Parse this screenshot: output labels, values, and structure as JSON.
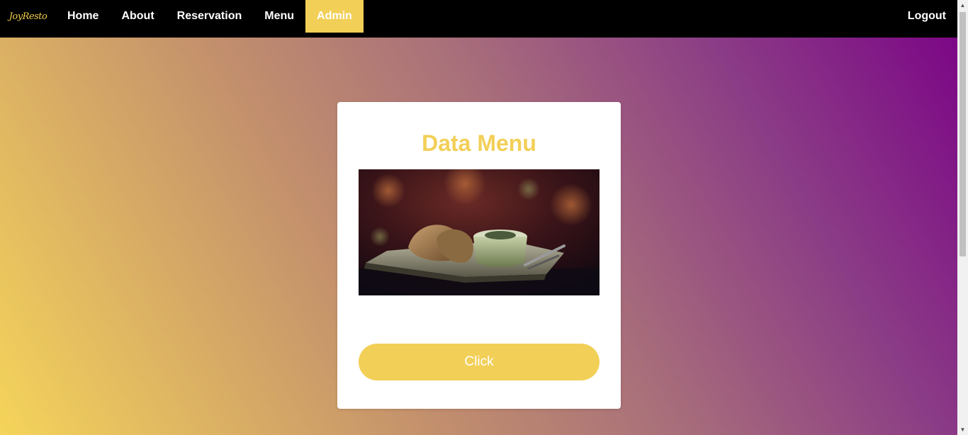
{
  "navbar": {
    "logo_text": "JoyResto",
    "links": [
      {
        "label": "Home"
      },
      {
        "label": "About"
      },
      {
        "label": "Reservation"
      },
      {
        "label": "Menu"
      },
      {
        "label": "Admin",
        "active": true
      }
    ],
    "logout_label": "Logout"
  },
  "card": {
    "title": "Data Menu",
    "image_alt": "plated-dish-photo",
    "button_label": "Click"
  },
  "colors": {
    "accent": "#f2cf57",
    "navbar_bg": "#000000",
    "gradient_start": "#f5d45a",
    "gradient_end": "#7a0086"
  }
}
